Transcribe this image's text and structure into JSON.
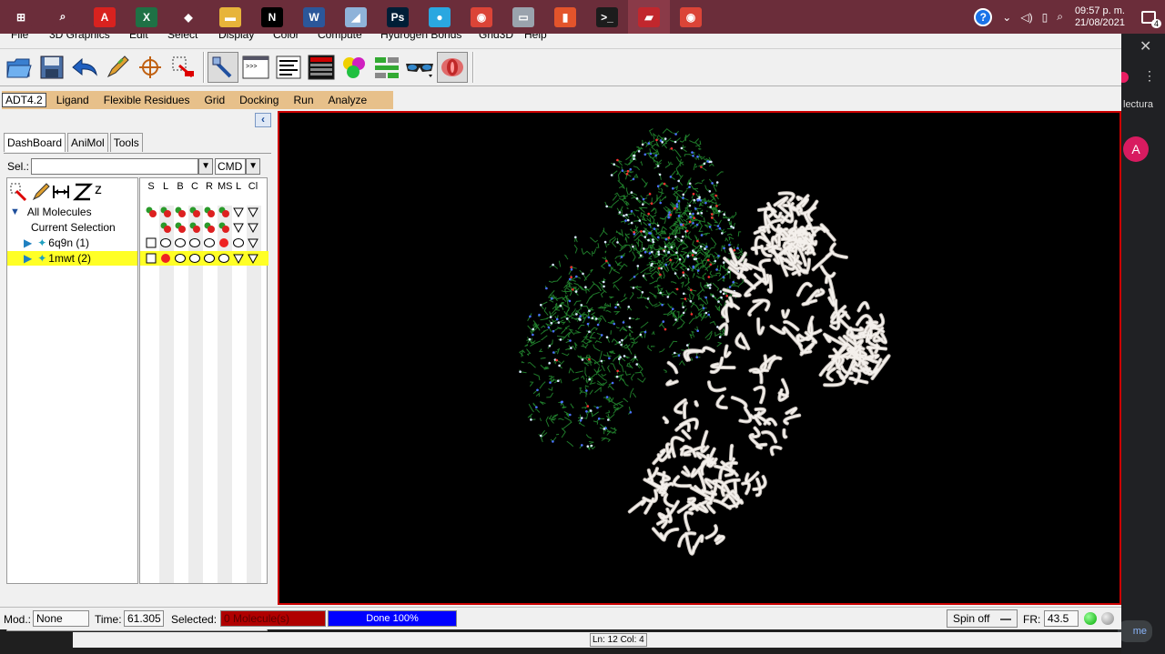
{
  "taskbar": {
    "apps": [
      {
        "name": "start",
        "glyph": "⊞",
        "color": "#6b2d3a"
      },
      {
        "name": "search",
        "glyph": "⌕",
        "color": "#6b2d3a"
      },
      {
        "name": "acrobat",
        "glyph": "A",
        "color": "#d8221f"
      },
      {
        "name": "excel",
        "glyph": "X",
        "color": "#1e7145"
      },
      {
        "name": "dropbox",
        "glyph": "◆",
        "color": "#6b2d3a"
      },
      {
        "name": "file-explorer",
        "glyph": "▬",
        "color": "#e7b43a"
      },
      {
        "name": "netflix",
        "glyph": "N",
        "color": "#000000"
      },
      {
        "name": "word",
        "glyph": "W",
        "color": "#2b579a"
      },
      {
        "name": "app-generic",
        "glyph": "◢",
        "color": "#8fb3d9"
      },
      {
        "name": "photoshop",
        "glyph": "Ps",
        "color": "#001e36"
      },
      {
        "name": "lightbulb",
        "glyph": "●",
        "color": "#2aa7e0"
      },
      {
        "name": "chrome",
        "glyph": "◉",
        "color": "#db4437"
      },
      {
        "name": "app-device",
        "glyph": "▭",
        "color": "#9aa3ad"
      },
      {
        "name": "office",
        "glyph": "▮",
        "color": "#e3542b"
      },
      {
        "name": "terminal",
        "glyph": ">_",
        "color": "#1c1c1c"
      },
      {
        "name": "app-red",
        "glyph": "▰",
        "color": "#c1272d"
      },
      {
        "name": "chrome-profile",
        "glyph": "◉",
        "color": "#db4437"
      }
    ],
    "tray": {
      "help": "?",
      "chevron": "⌃",
      "volume": "🔊",
      "time": "09:57 p. m.",
      "date": "21/08/2021",
      "notif_count": "4"
    }
  },
  "browser_sliver": {
    "text": "lectura",
    "avatar": "A",
    "bottom_text": "me"
  },
  "menubar": {
    "items": [
      "File",
      "3D Graphics",
      "Edit",
      "Select",
      "Display",
      "Color",
      "Compute",
      "Hydrogen Bonds",
      "Grid3D",
      "Help"
    ]
  },
  "toolbar": {
    "tools": [
      "open-molecule",
      "save",
      "undo",
      "pencil",
      "crosshair",
      "delete-selection",
      "pmv-command",
      "python-shell",
      "text-editor",
      "display-panel",
      "color-spheres",
      "layout",
      "stereo-glasses",
      "spin-icon"
    ]
  },
  "adtmenu": {
    "items": [
      "ADT4.2",
      "Ligand",
      "Flexible Residues",
      "Grid",
      "Docking",
      "Run",
      "Analyze"
    ]
  },
  "panel": {
    "collapse": "‹",
    "tabs": [
      "DashBoard",
      "AniMol",
      "Tools"
    ],
    "sel_label": "Sel.:",
    "sel_value": "",
    "cmd_value": "CMD",
    "col_headers": [
      "S",
      "L",
      "B",
      "C",
      "R",
      "MS",
      "L",
      "Cl"
    ],
    "tree": [
      {
        "label": "All Molecules",
        "level": 0,
        "expanded": true
      },
      {
        "label": "Current Selection",
        "level": 1,
        "expanded": false
      },
      {
        "label": "6q9n (1)",
        "level": 1,
        "expanded": false
      },
      {
        "label": "1mwt (2)",
        "level": 1,
        "expanded": false,
        "highlighted": true
      }
    ]
  },
  "status": {
    "mod_label": "Mod.:",
    "mod_value": "None",
    "time_label": "Time:",
    "time_value": "61.305",
    "selected_label": "Selected:",
    "selected_value": "0 Molecule(s)",
    "progress_text": "Done 100%",
    "progress": 1.0,
    "spin": "Spin off",
    "fr_label": "FR:",
    "fr_value": "43.5",
    "ln_col": "Ln: 12 Col: 4"
  },
  "colors": {
    "taskbar": "#6b2d3a",
    "adt_menu": "#e7c08a",
    "highlight": "#ffff26",
    "viewer_border": "#cc0000"
  }
}
